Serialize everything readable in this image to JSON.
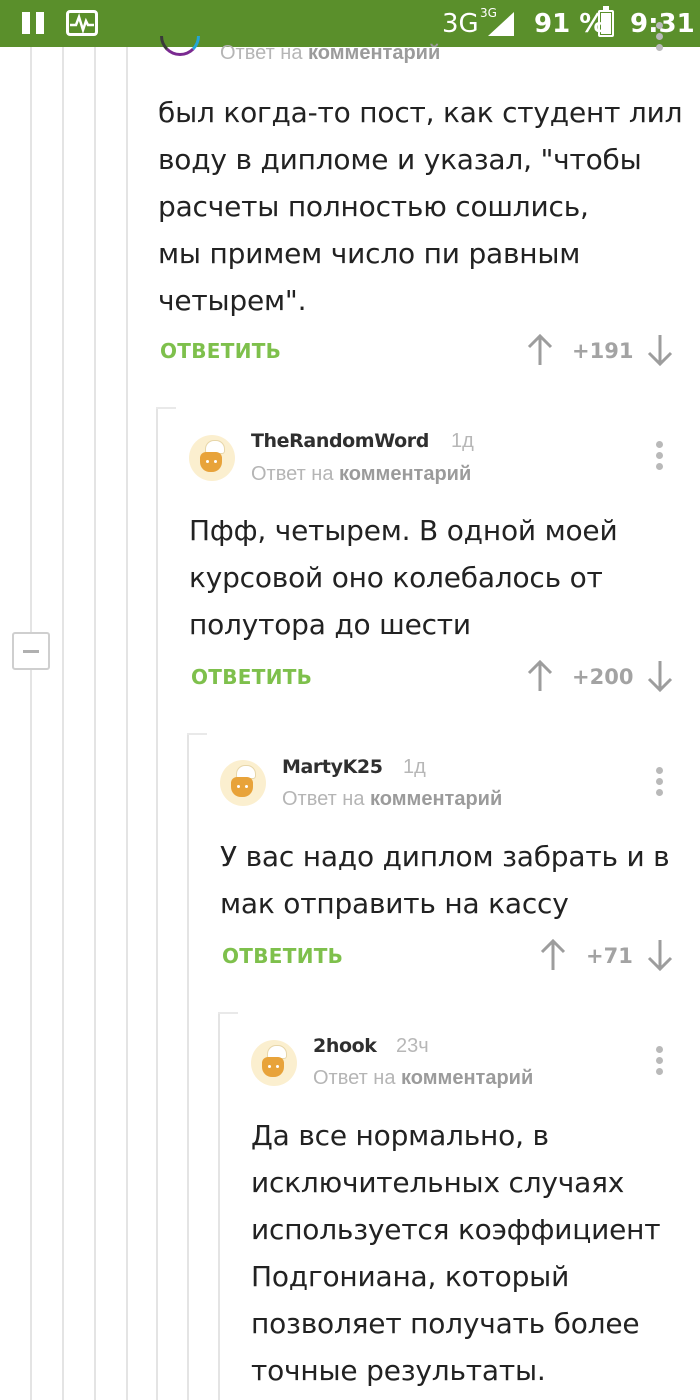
{
  "status_bar": {
    "network": "3G",
    "network_sup": "3G",
    "battery": "91 %",
    "battery_level": 0.91,
    "time": "9:31",
    "icons": [
      "pause-icon",
      "activity-icon",
      "signal-icon",
      "battery-icon"
    ]
  },
  "comments": [
    {
      "reply_to_prefix": "Ответ на",
      "reply_to_target": "комментарий",
      "text": "был когда-то пост, как студент лил\nводу в дипломе и указал, \"чтобы\nрасчеты полностью сошлись,\nмы примем число пи равным\nчетырем\".",
      "reply_label": "ОТВЕТИТЬ",
      "score": "+191"
    },
    {
      "author": "TheRandomWord",
      "time": "1д",
      "reply_to_prefix": "Ответ на",
      "reply_to_target": "комментарий",
      "text": "Пфф, четырем. В одной моей\nкурсовой оно колебалось от\nполутора до шести",
      "reply_label": "ОТВЕТИТЬ",
      "score": "+200"
    },
    {
      "author": "MartyK25",
      "time": "1д",
      "reply_to_prefix": "Ответ на",
      "reply_to_target": "комментарий",
      "text": "У вас надо диплом забрать и в\nмак отправить на кассу",
      "reply_label": "ОТВЕТИТЬ",
      "score": "+71"
    },
    {
      "author": "2hook",
      "time": "23ч",
      "reply_to_prefix": "Ответ на",
      "reply_to_target": "комментарий",
      "text": "Да все нормально, в\nисключительных случаях\nиспользуется коэффициент\nПодгониана, который\nпозволяет получать более\nточные результаты."
    }
  ],
  "colors": {
    "status_bar": "#5a8f2b",
    "reply_green": "#7ec04c",
    "score_gray": "#a3a3a3",
    "thread_line": "#e4e4e4"
  }
}
